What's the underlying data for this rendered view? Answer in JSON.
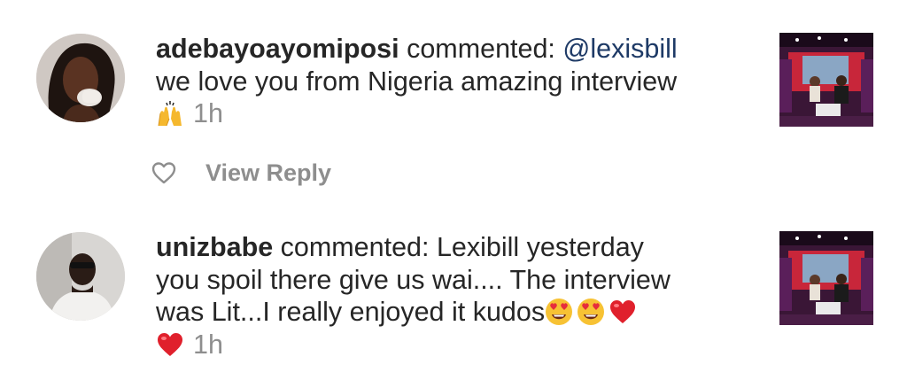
{
  "notifications": [
    {
      "username": "adebayoayomiposi",
      "verb": "commented:",
      "mention": "@lexisbill",
      "line2": "we love you from Nigeria amazing interview",
      "emoji_1": "raising-hands-emoji",
      "time": "1h",
      "view_reply_label": "View Reply"
    },
    {
      "username": "unizbabe",
      "verb": "commented:",
      "line1_rest": "Lexibill yesterday",
      "line2": "you spoil there give us wai.... The interview",
      "line3": "was Lit...I really enjoyed it kudos",
      "emoji_1": "heart-eyes-emoji",
      "emoji_2": "heart-eyes-emoji",
      "emoji_3": "red-heart-emoji",
      "emoji_4": "red-heart-emoji",
      "time": "1h"
    }
  ],
  "colors": {
    "text": "#262626",
    "muted": "#8e8e8e",
    "mention": "#1e3a66",
    "heart": "#e0202c"
  }
}
